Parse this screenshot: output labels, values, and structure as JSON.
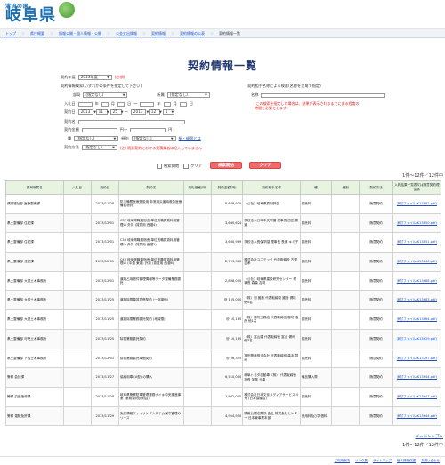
{
  "header": {
    "logo_sub": "清流の国",
    "logo_main": "岐阜県"
  },
  "breadcrumb": [
    "トップ",
    "県庁概要",
    "情報公開・個人情報・公開",
    "公金支出情報",
    "契約情報",
    "契約情報の公表",
    "契約情報一覧"
  ],
  "page_title": "契約情報一覧",
  "form": {
    "year_label": "契約年度",
    "year_value": "2013年度",
    "required": "(必須)",
    "search_hint": "契約情報検索(いずれかの条件を指定して下さい)",
    "dept_label": "部局",
    "dept_value": "(指定なし)",
    "office_label": "所属",
    "office_value": "(指定なし)",
    "bid_date_label": "入札日",
    "contract_date_label": "契約日",
    "cd_from": [
      "2013",
      "11",
      "25"
    ],
    "cd_to": [
      "2013",
      "12",
      "1"
    ],
    "ymd": [
      "年",
      "月",
      "日",
      "～"
    ],
    "contract_name_label": "契約名",
    "contract_amount_label": "契約金額",
    "yen": "円～",
    "yen_end": "円",
    "category_label": "種",
    "category_value": "(指定なし)",
    "category2_label": "細別",
    "category2_value": "(指定なし)",
    "category_link": "細・細節とは",
    "method_label": "契約方法",
    "method_value": "(指定なし)",
    "method_note": "(注) 随意契約における見積業者は記入していません",
    "partner_hint": "契約相手名称による検索(名称を全角で指定)",
    "partner_name_label": "名称",
    "partner_note": "(この検索を指定した場合は、結果が表示されるまでにある程度の時間を必要とします)"
  },
  "controls": {
    "clear_label": "検索開始",
    "clear2_label": "クリア",
    "search_button": "検索開始",
    "clear_button": "クリア"
  },
  "pager": "1件～12件／12件中",
  "pagetop": "ページトップへ",
  "table": {
    "headers": [
      "部局所属名",
      "入札日",
      "契約日",
      "契約名",
      "落札価格(円)",
      "契約金額(円)",
      "契約相手名称",
      "種",
      "細別",
      "契約方法",
      "入札結果一覧表又は随意契約理由書"
    ],
    "rows": [
      [
        "健康福祉部 医療整備課",
        "",
        "2013/11/28",
        "防災備蓄医療施設用 非常用災害時救急医療備蓄物資",
        "",
        "8,688,930",
        "（公社）岐阜県薬剤師会",
        "委託料",
        "",
        "随意契約",
        "添付ファイル(K13882.pdf)"
      ],
      [
        "県土整備部 住宅課",
        "",
        "2013/12/01",
        "C37 岐阜県職員宿舎 単位別職員賃料用管理の 外賃 (賃貸用 西濃4)",
        "",
        "3,630,624",
        "学校法人日本中央学園 理事長 西田 慶道",
        "委託料",
        "",
        "随意契約",
        "添付ファイル(K13850.pdf)"
      ],
      [
        "県土整備部 住宅課",
        "",
        "2013/12/01",
        "C38 岐阜県職員宿舎 単位別職員賃料用管理の 外賃 (賃貸用 西濃2)",
        "",
        "3,630,989",
        "学校法人長保学園 理事長 長瀬 キミ子",
        "委託料",
        "",
        "随意契約",
        "添付ファイル(K13851.pdf)"
      ],
      [
        "県土整備部 住宅課",
        "",
        "2013/12/01",
        "C40 岐阜県職員宿舎 単位別職員賃料用管理の (中濃 東濃) 外賃 (賃貸用 西濃6)",
        "",
        "2,703,360",
        "株式会社ユニテック 代表取締役 古堅 吉孝",
        "委託料",
        "",
        "随意契約",
        "添付ファイル(K13846.pdf)"
      ],
      [
        "県土整備部 大垣土木事務所",
        "",
        "2013/12/01",
        "道路占用物件管理情報等データ整備業務委託",
        "",
        "2,898,000",
        "（公社）岐阜県建設研究センター 理事長 森森 吉明",
        "委託料",
        "",
        "随意契約",
        "添付ファイル(K13688.pdf)"
      ],
      [
        "県土整備部 大垣土木事務所",
        "",
        "2013/11/25",
        "道路除雪車賃貸借契約 (一部単価)",
        "",
        "@ 105,000",
        "（株）河 國島 代表取締役 國島 健雄 他5名",
        "委託料",
        "",
        "随意契約",
        "添付ファイル(K13683.pdf)"
      ],
      [
        "県土整備部 大垣土木事務所",
        "",
        "2013/11/25",
        "道路除雪業務委託契約 (地域雪)",
        "",
        "@ 10,165",
        "（株）藤坊工務店 代表取締役 藤坊 浩然 他1名",
        "委託料",
        "",
        "随意契約",
        "添付ファイル(K13664.pdf)"
      ],
      [
        "県土整備部 可児土木事務所",
        "",
        "2013/11/25",
        "除雪業務委託契約",
        "",
        "@ 10,185",
        "（株）富山建 代表取締役 富山 健司 他3名",
        "委託料",
        "",
        "随意契約",
        "添付ファイル(K13629.pdf)"
      ],
      [
        "県土整備部 下呂土木事務所",
        "",
        "2013/12/01",
        "除雪業務委託単価契約",
        "",
        "@ 26,355",
        "富田興産株式会社 代表取締役 森本 賢司",
        "委託料",
        "",
        "随意契約",
        "添付ファイル(K13797.pdf)"
      ],
      [
        "警察 会計課",
        "",
        "2013/11/27",
        "協議用車 (A型) の購入",
        "",
        "6,510,000",
        "岐阜トヨタ自動車（株） 代表取締役社長 加藤 元康",
        "備品購入費",
        "",
        "随意契約",
        "添付ファイル(K13644.pdf)"
      ],
      [
        "警察 交通指導課",
        "",
        "2013/11/28",
        "岐阜県警察駐車管理業務ナイキ中央推進事業 (業務規則説明会)",
        "",
        "1,932,000",
        "株式会社日本文化メディアサービス 4号 (日本協議会)",
        "委託料",
        "",
        "随意契約",
        "添付ファイル(K13647.pdf)"
      ],
      [
        "警察 運転免許課",
        "",
        "2013/11/29",
        "免許情報ファイリングシステム保守管理のリース",
        "",
        "4,954,950",
        "情報公開法関係 会社 株式会社センター 日本東事業本部",
        "使用料及び賃借料",
        "",
        "随意契約",
        "添付ファイル(K13644.pdf)"
      ]
    ]
  },
  "footer": [
    "ご利用案内",
    "リンク集",
    "サイトマップ",
    "個人情報保護",
    "お問い合わせ"
  ]
}
